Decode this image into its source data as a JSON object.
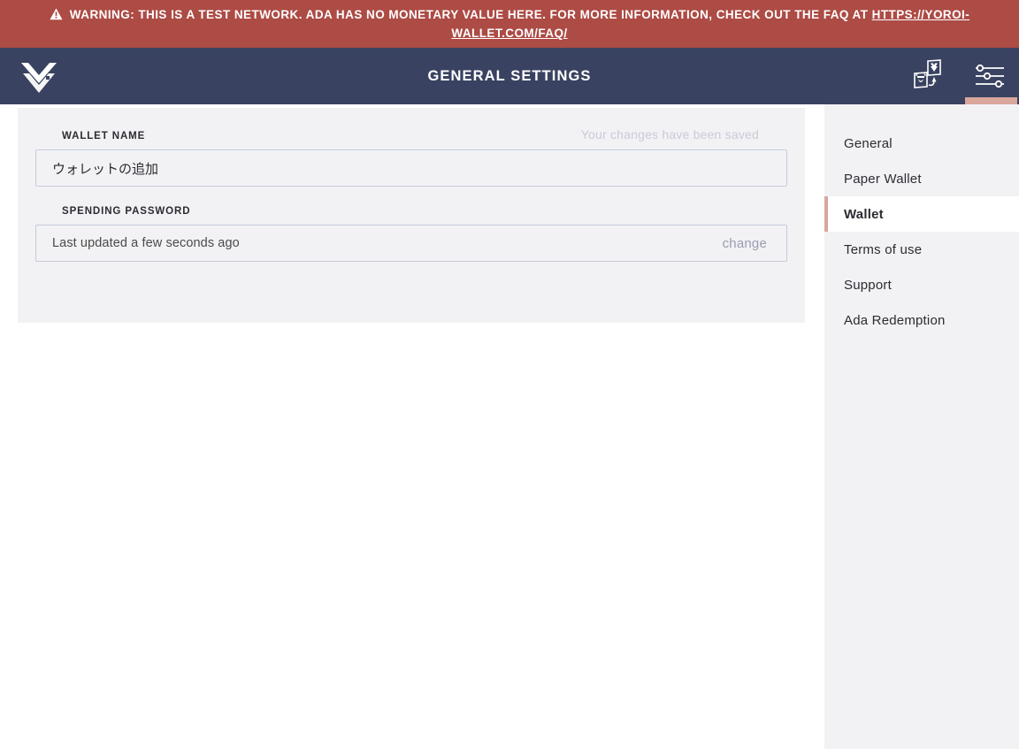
{
  "banner": {
    "icon": "warning-triangle-icon",
    "text_before": "Warning: this is a test network. ADA has no monetary value here. For more information, check out the FAQ at ",
    "link_text": "https://yoroi-wallet.com/faq/",
    "bg_color": "#ad4b45"
  },
  "topbar": {
    "logo_name": "yoroi-logo",
    "title": "General Settings",
    "bg_color": "#394260",
    "actions": [
      {
        "name": "wallet-switch-icon",
        "label": "Switch wallet",
        "active": false
      },
      {
        "name": "settings-sliders-icon",
        "label": "Settings",
        "active": true
      }
    ],
    "active_indicator_color": "#d9a69c"
  },
  "settings": {
    "wallet_name": {
      "label": "Wallet name",
      "value": "ウォレットの追加",
      "placeholder": "Wallet name"
    },
    "saved_message": "Your changes have been saved",
    "spending_password": {
      "label": "Spending password",
      "status": "Last updated a few seconds ago",
      "change_label": "change"
    }
  },
  "menu": {
    "items": [
      {
        "label": "General",
        "active": false
      },
      {
        "label": "Paper Wallet",
        "active": false
      },
      {
        "label": "Wallet",
        "active": true
      },
      {
        "label": "Terms of use",
        "active": false
      },
      {
        "label": "Support",
        "active": false
      },
      {
        "label": "Ada Redemption",
        "active": false
      }
    ],
    "active_accent_color": "#d9a69c"
  }
}
